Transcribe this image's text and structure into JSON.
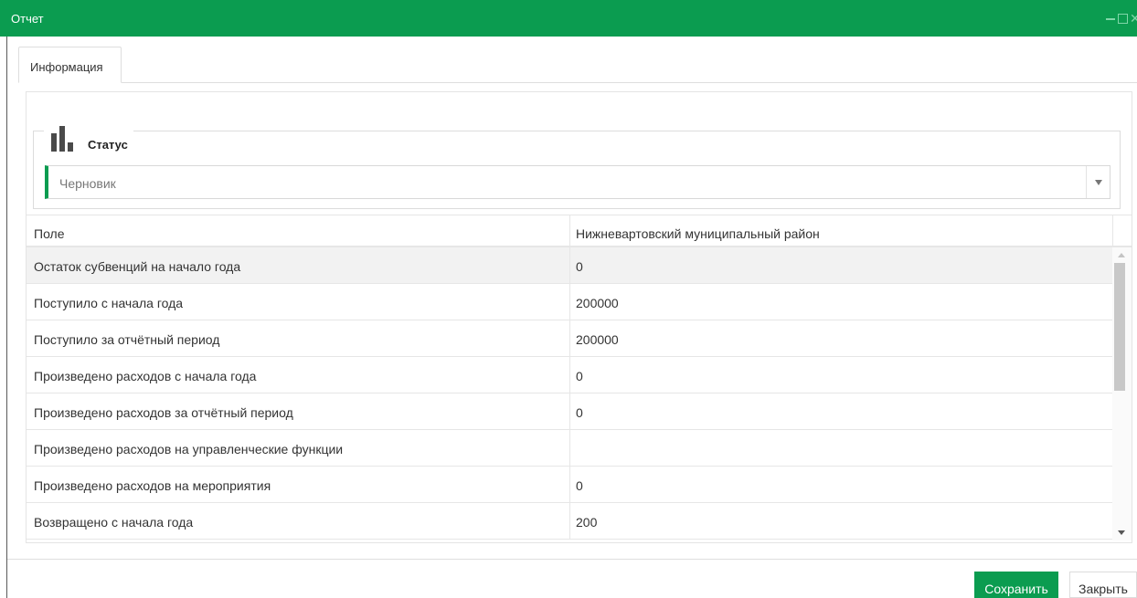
{
  "window": {
    "title": "Отчет",
    "accent_color": "#0b9c50"
  },
  "tabs": [
    {
      "label": "Информация",
      "active": true
    }
  ],
  "status": {
    "label": "Статус",
    "icon": "bar-chart-icon",
    "selected_value": "Черновик"
  },
  "table": {
    "headers": [
      "Поле",
      "Нижневартовский муниципальный район"
    ],
    "rows": [
      {
        "field": "Остаток субвенций на начало года",
        "value": "0",
        "selected": true
      },
      {
        "field": "Поступило с начала года",
        "value": "200000"
      },
      {
        "field": "Поступило за отчётный период",
        "value": "200000"
      },
      {
        "field": "Произведено расходов с начала года",
        "value": "0"
      },
      {
        "field": "Произведено расходов за отчётный период",
        "value": "0"
      },
      {
        "field": "Произведено расходов на управленческие функции",
        "value": ""
      },
      {
        "field": "Произведено расходов на мероприятия",
        "value": "0"
      },
      {
        "field": "Возвращено с начала года",
        "value": "200"
      }
    ]
  },
  "footer": {
    "save_label": "Сохранить",
    "close_label": "Закрыть"
  }
}
